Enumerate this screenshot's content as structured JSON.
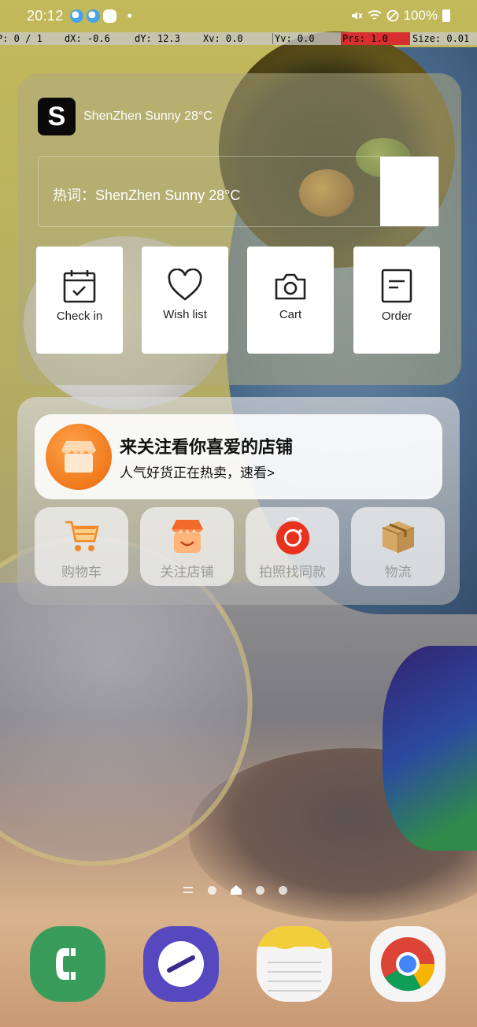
{
  "status_bar": {
    "time": "20:12",
    "battery": "100%",
    "left_icons": [
      "weather-icon",
      "weather-icon",
      "line-app-icon",
      "notification-dot"
    ],
    "right_icons": [
      "mute-icon",
      "wifi-icon",
      "do-not-disturb-icon",
      "battery-icon"
    ]
  },
  "pointer_location": {
    "p": "P: 0 / 1",
    "dx": "dX: -0.6",
    "dy": "dY: 12.3",
    "xv": "Xv: 0.0",
    "yv": "Yv: 0.0",
    "prs": "Prs: 1.0",
    "size": "Size: 0.01"
  },
  "widget_shop": {
    "logo_letter": "S",
    "title": "ShenZhen Sunny 28°C",
    "hot_search": "热词：ShenZhen Sunny 28°C",
    "shortcuts": [
      {
        "label": "Check in",
        "icon": "calendar-check-icon"
      },
      {
        "label": "Wish list",
        "icon": "heart-icon"
      },
      {
        "label": "Cart",
        "icon": "camera-icon"
      },
      {
        "label": "Order",
        "icon": "order-document-icon"
      }
    ]
  },
  "widget_taobao": {
    "promo_title": "来关注看你喜爱的店铺",
    "promo_subtitle": "人气好货正在热卖，速看>",
    "quick_actions": [
      {
        "label": "购物车",
        "icon": "shopping-cart-icon"
      },
      {
        "label": "关注店铺",
        "icon": "shop-icon"
      },
      {
        "label": "拍照找同款",
        "icon": "camera-search-icon"
      },
      {
        "label": "物流",
        "icon": "package-box-icon"
      }
    ]
  },
  "page_indicator": {
    "pages": 4,
    "current": 2
  },
  "dock": [
    {
      "app": "Phone",
      "icon": "phone-icon",
      "color": "#3c9a5a"
    },
    {
      "app": "Internet",
      "icon": "internet-browser-icon",
      "color": "#5a4cc2"
    },
    {
      "app": "Notes",
      "icon": "notes-icon",
      "color": "#f0d850"
    },
    {
      "app": "Chrome",
      "icon": "chrome-icon",
      "color": "#ffffff"
    }
  ]
}
